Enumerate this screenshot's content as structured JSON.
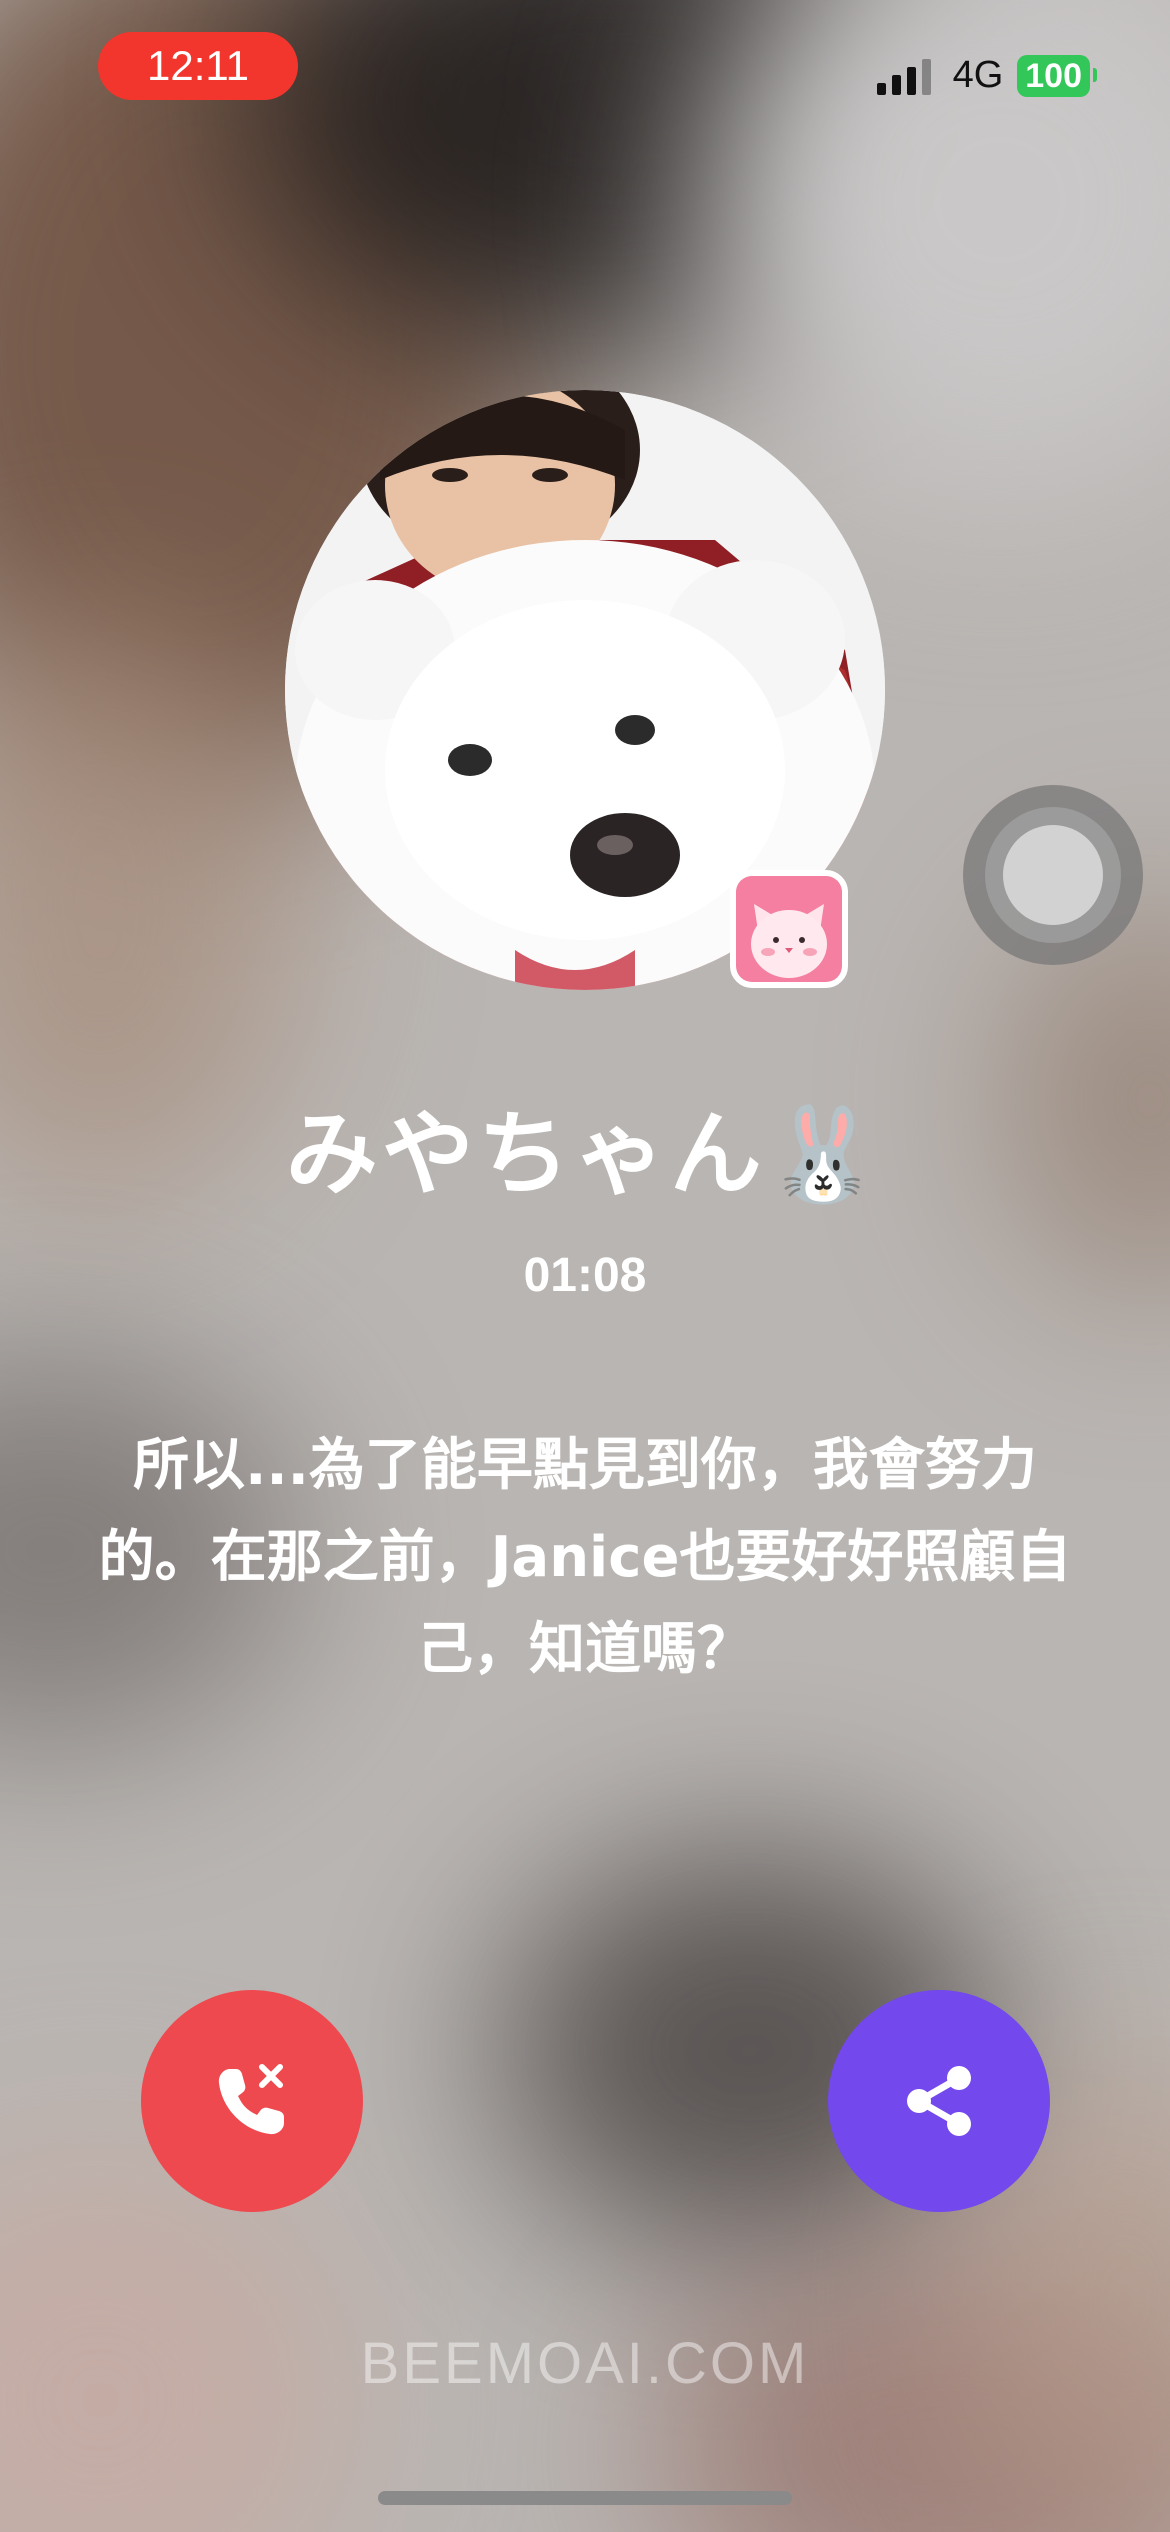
{
  "status_bar": {
    "time": "12:11",
    "network": "4G",
    "battery": "100",
    "colors": {
      "time_pill": "#f2362e",
      "battery": "#33c759"
    }
  },
  "caller": {
    "avatar_icon": "avatar-photo",
    "app_badge_icon": "pink-cat-app-icon",
    "name": "みやちゃん🐰",
    "duration": "01:08",
    "message": "所以...為了能早點見到你，我會努力的。在那之前，Janice也要好好照顧自己，知道嗎？"
  },
  "controls": {
    "hangup_icon": "phone-hangup-icon",
    "share_icon": "share-icon",
    "colors": {
      "hangup": "#ef4950",
      "share": "#7348ec"
    }
  },
  "watermark": "BEEMOAI.COM"
}
